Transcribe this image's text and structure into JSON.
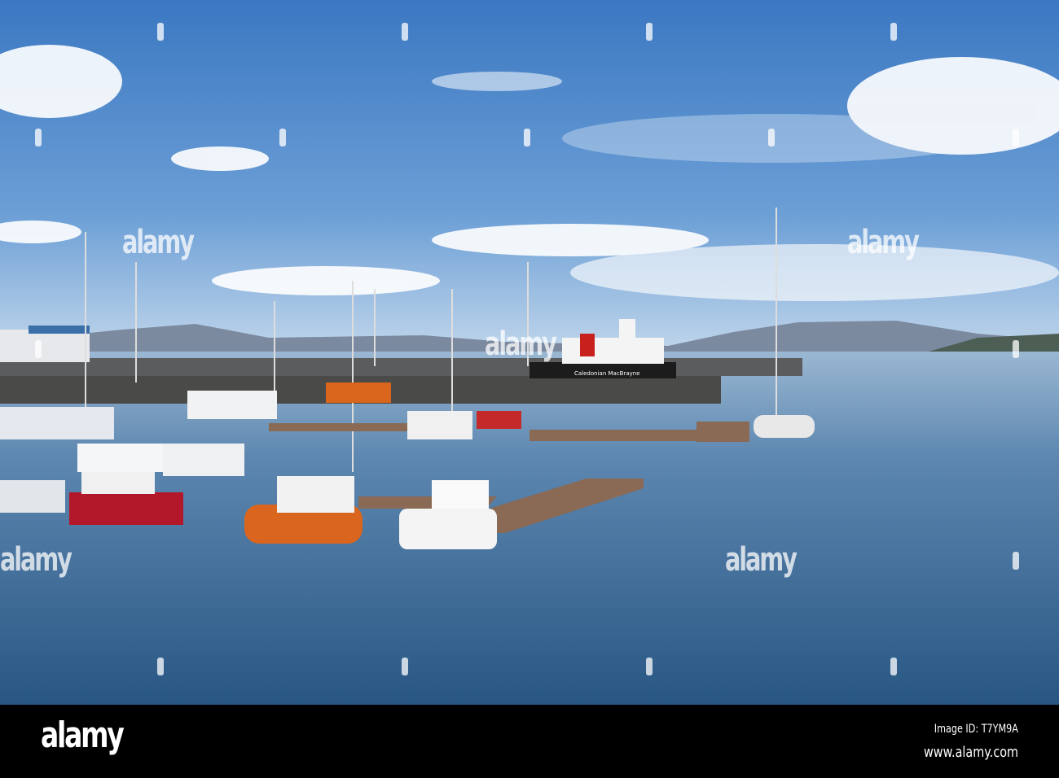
{
  "photo": {
    "subject": "harbour marina",
    "ferry_name": "Caledonian MacBrayne",
    "colors": {
      "sky_top": "#3d7cc4",
      "sky_bottom": "#a9c9e8",
      "water_top": "#8fb0cf",
      "water_bottom": "#2c5a86",
      "ferry_red": "#c8201c"
    }
  },
  "watermark": {
    "text": "alamy"
  },
  "footer": {
    "logo": "alamy",
    "image_id": "Image ID: T7YM9A",
    "url": "www.alamy.com"
  }
}
